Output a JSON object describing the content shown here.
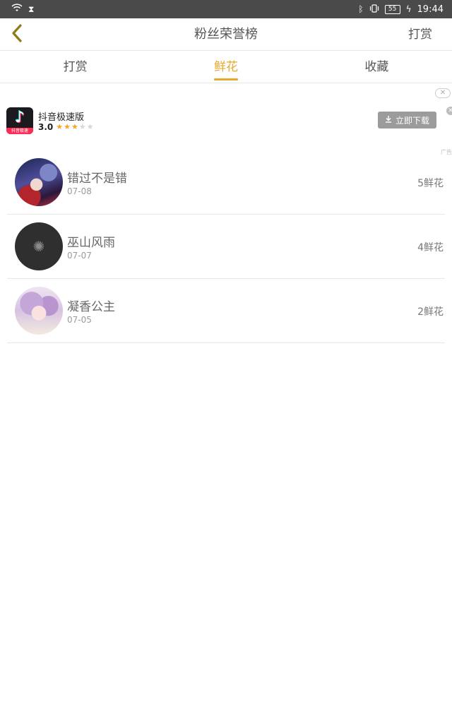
{
  "status_bar": {
    "time": "19:44",
    "battery": "55",
    "left_icons": [
      "wifi-icon",
      "hourglass-icon"
    ],
    "right_icons": [
      "bluetooth-icon",
      "vibrate-icon",
      "battery-icon",
      "charging-icon"
    ]
  },
  "header": {
    "title": "粉丝荣誉榜",
    "action_label": "打赏",
    "back_icon": "chevron-left-icon",
    "accent_color": "#e8a82a"
  },
  "tabs": [
    {
      "label": "打赏",
      "active": false
    },
    {
      "label": "鲜花",
      "active": true
    },
    {
      "label": "收藏",
      "active": false
    }
  ],
  "ad": {
    "app_name": "抖音极速版",
    "rating": "3.0",
    "stars_filled": 3,
    "stars_total": 5,
    "download_label": "立即下载",
    "icon_strip_text": "抖音极速",
    "tag": "广告"
  },
  "ranking": [
    {
      "name": "错过不是错",
      "date": "07-08",
      "count": "5鲜花"
    },
    {
      "name": "巫山风雨",
      "date": "07-07",
      "count": "4鲜花"
    },
    {
      "name": "凝香公主",
      "date": "07-05",
      "count": "2鲜花"
    }
  ]
}
